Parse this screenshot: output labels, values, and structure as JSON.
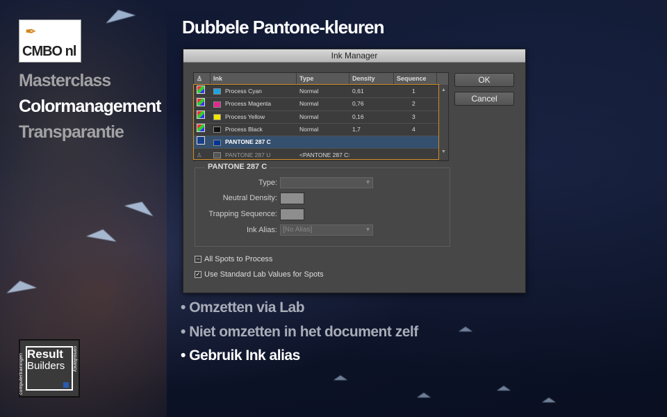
{
  "logo": {
    "cmbo_text": "CMBO nl"
  },
  "side_menu": [
    {
      "label": "Masterclass",
      "active": false
    },
    {
      "label": "Colormanagement",
      "active": true
    },
    {
      "label": "Transparantie",
      "active": false
    }
  ],
  "slide": {
    "title": "Dubbele Pantone-kleuren"
  },
  "dialog": {
    "title": "Ink Manager",
    "headers": [
      "Ink",
      "Type",
      "Density",
      "Sequence"
    ],
    "rows": [
      {
        "ink": "Process Cyan",
        "type": "Normal",
        "density": "0,61",
        "sequence": "1",
        "swatch": "#1fa3e0"
      },
      {
        "ink": "Process Magenta",
        "type": "Normal",
        "density": "0,76",
        "sequence": "2",
        "swatch": "#e0288c"
      },
      {
        "ink": "Process Yellow",
        "type": "Normal",
        "density": "0,16",
        "sequence": "3",
        "swatch": "#f5e600"
      },
      {
        "ink": "Process Black",
        "type": "Normal",
        "density": "1,7",
        "sequence": "4",
        "swatch": "#111111"
      },
      {
        "ink": "PANTONE 287 C",
        "type": "",
        "density": "",
        "sequence": "",
        "swatch": "#003594"
      },
      {
        "ink": "PANTONE 287 U",
        "type": "<PANTONE 287 C>",
        "density": "",
        "sequence": "",
        "swatch": "#6a6a6a"
      }
    ],
    "ok_label": "OK",
    "cancel_label": "Cancel",
    "group_title": "PANTONE 287 C",
    "type_label": "Type:",
    "neutral_density_label": "Neutral Density:",
    "trapping_label": "Trapping Sequence:",
    "ink_alias_label": "Ink Alias:",
    "ink_alias_value": "[No Alias]",
    "all_spots_label": "All Spots to Process",
    "use_lab_label": "Use Standard Lab Values for Spots"
  },
  "bullets": [
    {
      "text": "Omzetten via Lab"
    },
    {
      "text": "Niet omzetten in het document zelf"
    },
    {
      "text": "Gebruik Ink alias"
    }
  ],
  "brand": {
    "result": "Result",
    "builders": "Builders",
    "left_vertical": "computertrainingen",
    "right_vertical": "consultancy"
  },
  "colors": {
    "accent_orange": "#d08c26",
    "selection_blue": "#35506e"
  }
}
